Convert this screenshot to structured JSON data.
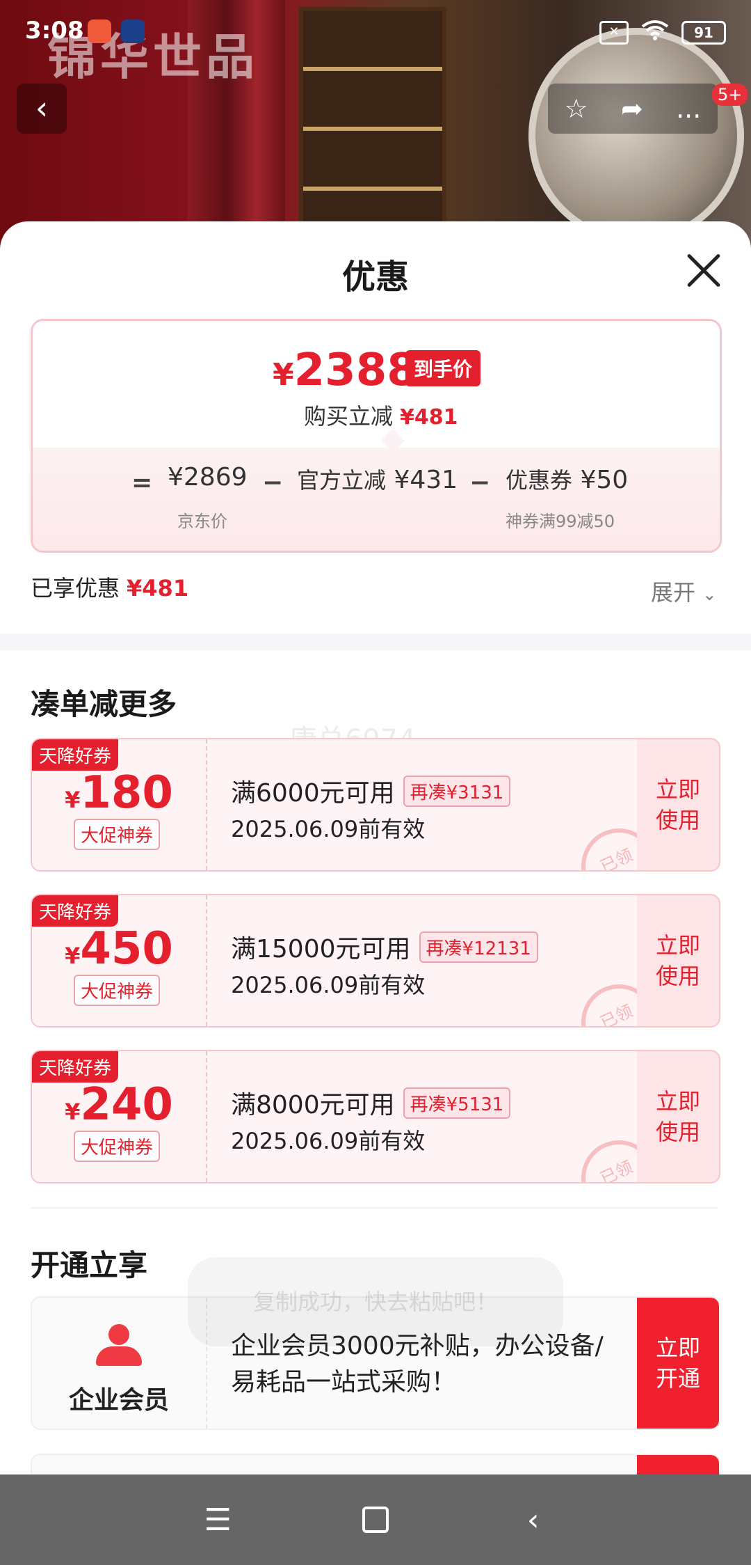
{
  "status_bar": {
    "time": "3:08",
    "battery": "91",
    "wifi_icon": "wifi-icon",
    "sim_icon": "sim-off-icon"
  },
  "banner": {
    "brand_text": "锦华世品"
  },
  "top_nav": {
    "back_icon": "back-arrow-icon",
    "star_icon": "star-icon",
    "share_icon": "share-icon",
    "more_label": "...",
    "badge": "5+"
  },
  "sheet": {
    "title": "优惠",
    "close_icon": "close-icon"
  },
  "price_card": {
    "final_price_symbol": "¥",
    "final_price": "2388",
    "final_price_tag": "到手价",
    "discount_label": "购买立减",
    "discount_value": "¥481",
    "equals": "=",
    "minus1": "−",
    "minus2": "−",
    "jd_price": "¥2869",
    "jd_price_label": "京东价",
    "official_cut_label": "官方立减",
    "official_cut_value": "¥431",
    "coupon_label": "优惠券",
    "coupon_value": "¥50",
    "coupon_sub": "神券满99减50"
  },
  "enjoyed": {
    "label": "已享优惠",
    "value": "¥481",
    "expand_label": "展开"
  },
  "section_more": {
    "title": "凑单减更多"
  },
  "coupons": [
    {
      "ribbon": "天降好券",
      "symbol": "¥",
      "amount": "180",
      "kind": "大促神券",
      "condition": "满6000元可用",
      "more": "再凑¥3131",
      "valid": "2025.06.09前有效",
      "use": "立即使用",
      "stamp": "已领"
    },
    {
      "ribbon": "天降好券",
      "symbol": "¥",
      "amount": "450",
      "kind": "大促神券",
      "condition": "满15000元可用",
      "more": "再凑¥12131",
      "valid": "2025.06.09前有效",
      "use": "立即使用",
      "stamp": "已领"
    },
    {
      "ribbon": "天降好券",
      "symbol": "¥",
      "amount": "240",
      "kind": "大促神券",
      "condition": "满8000元可用",
      "more": "再凑¥5131",
      "valid": "2025.06.09前有效",
      "use": "立即使用",
      "stamp": "已领"
    }
  ],
  "watermark": "康总6974",
  "section_open": {
    "title": "开通立享"
  },
  "member": {
    "label": "企业会员",
    "desc": "企业会员3000元补贴，办公设备/易耗品一站式采购！",
    "open": "立即开通"
  },
  "toast": "复制成功，快去粘贴吧！",
  "system_nav": {
    "menu_icon": "menu-icon",
    "home_icon": "home-square-icon",
    "back_icon": "back-chevron-icon"
  },
  "colors": {
    "accent": "#e5202e",
    "coupon_bg": "#fff4f5",
    "coupon_border": "#f5c7cc"
  }
}
